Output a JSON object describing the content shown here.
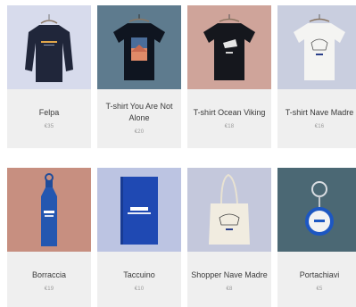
{
  "products": [
    {
      "name": "Felpa",
      "price": "€35",
      "bg": "#d7dbec",
      "icon": "sweatshirt-icon"
    },
    {
      "name": "T-shirt You Are Not Alone",
      "price": "€20",
      "bg": "#5e7b8e",
      "icon": "tshirt-icon"
    },
    {
      "name": "T-shirt Ocean Viking",
      "price": "€18",
      "bg": "#cfa49a",
      "icon": "tshirt-icon"
    },
    {
      "name": "T-shirt Nave Madre",
      "price": "€16",
      "bg": "#c9cedf",
      "icon": "tshirt-icon"
    },
    {
      "name": "Borraccia",
      "price": "€19",
      "bg": "#c78f80",
      "icon": "water-bottle-icon"
    },
    {
      "name": "Taccuino",
      "price": "€10",
      "bg": "#bcc4e2",
      "icon": "notebook-icon"
    },
    {
      "name": "Shopper Nave Madre",
      "price": "€8",
      "bg": "#c4c8dc",
      "icon": "tote-bag-icon"
    },
    {
      "name": "Portachiavi",
      "price": "€5",
      "bg": "#4b6874",
      "icon": "keychain-icon"
    }
  ]
}
